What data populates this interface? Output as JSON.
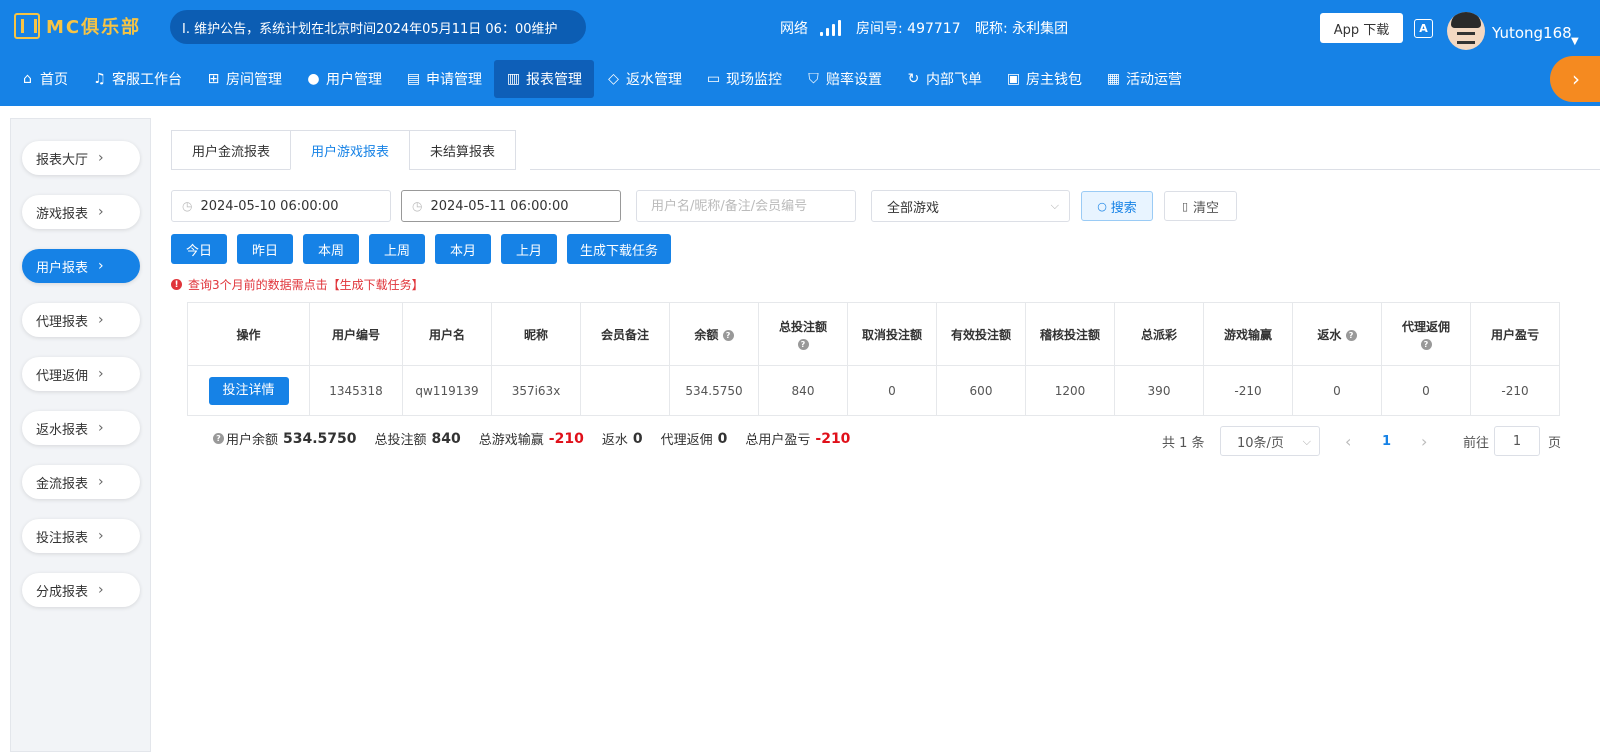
{
  "topbar": {
    "logo_text": "MC俱乐部",
    "notice": "Ⅰ. 维护公告，系统计划在北京时间2024年05月11日 06：00维护",
    "network_label": "网络",
    "room_label": "房间号: 497717",
    "nickname_label": "昵称: 永利集团",
    "app_download": "App 下载",
    "lang_icon_text": "A",
    "username": "Yutong168"
  },
  "nav": {
    "items": [
      {
        "label": "首页",
        "icon": "home-icon"
      },
      {
        "label": "客服工作台",
        "icon": "headset-icon"
      },
      {
        "label": "房间管理",
        "icon": "grid-icon"
      },
      {
        "label": "用户管理",
        "icon": "user-icon"
      },
      {
        "label": "申请管理",
        "icon": "document-icon"
      },
      {
        "label": "报表管理",
        "icon": "bar-chart-icon"
      },
      {
        "label": "返水管理",
        "icon": "tag-icon"
      },
      {
        "label": "现场监控",
        "icon": "monitor-icon"
      },
      {
        "label": "赔率设置",
        "icon": "shield-icon"
      },
      {
        "label": "内部飞单",
        "icon": "refresh-icon"
      },
      {
        "label": "房主钱包",
        "icon": "wallet-icon"
      },
      {
        "label": "活动运营",
        "icon": "gift-icon"
      }
    ],
    "active": "报表管理"
  },
  "sidebar": {
    "items": [
      "报表大厅",
      "游戏报表",
      "用户报表",
      "代理报表",
      "代理返佣",
      "返水报表",
      "金流报表",
      "投注报表",
      "分成报表"
    ],
    "active": "用户报表"
  },
  "tabs": {
    "items": [
      "用户金流报表",
      "用户游戏报表",
      "未结算报表"
    ],
    "active": "用户游戏报表"
  },
  "filters": {
    "start_time": "2024-05-10 06:00:00",
    "end_time": "2024-05-11 06:00:00",
    "user_placeholder": "用户名/昵称/备注/会员编号",
    "game_select": "全部游戏",
    "search_label": "搜索",
    "clear_label": "清空"
  },
  "quick_buttons": [
    "今日",
    "昨日",
    "本周",
    "上周",
    "本月",
    "上月",
    "生成下载任务"
  ],
  "warning": "查询3个月前的数据需点击【生成下载任务】",
  "table": {
    "headers": [
      "操作",
      "用户编号",
      "用户名",
      "昵称",
      "会员备注",
      "余额",
      "总投注额",
      "取消投注额",
      "有效投注额",
      "稽核投注额",
      "总派彩",
      "游戏输赢",
      "返水",
      "代理返佣",
      "用户盈亏"
    ],
    "row": {
      "action": "投注详情",
      "user_id": "1345318",
      "username": "qw119139",
      "nickname": "357i63x",
      "remark": "",
      "balance": "534.5750",
      "total_bet": "840",
      "cancel_bet": "0",
      "valid_bet": "600",
      "audit_bet": "1200",
      "total_payout": "390",
      "game_win": "-210",
      "rebate": "0",
      "agent_commission": "0",
      "user_pnl": "-210"
    }
  },
  "summary": {
    "balance_label": "用户余额",
    "balance": "534.5750",
    "total_bet_label": "总投注额",
    "total_bet": "840",
    "total_win_label": "总游戏输赢",
    "total_win": "-210",
    "rebate_label": "返水",
    "rebate": "0",
    "agent_label": "代理返佣",
    "agent": "0",
    "pnl_label": "总用户盈亏",
    "pnl": "-210"
  },
  "pagination": {
    "total": "共 1 条",
    "page_size": "10条/页",
    "current_page": "1",
    "goto_label": "前往",
    "goto_value": "1",
    "page_suffix": "页"
  },
  "colors": {
    "primary": "#1682e6",
    "positive": "#2c8a2c",
    "negative": "#e0101a",
    "accent_orange": "#f58a20"
  }
}
